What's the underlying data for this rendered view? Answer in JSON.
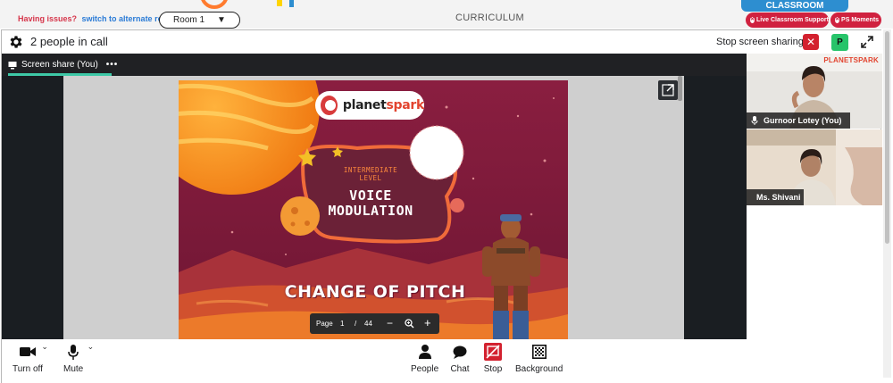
{
  "top_bar": {
    "issue_text": "Having issues?",
    "alternate_link": "switch to alternate room",
    "room_label": "Room 1",
    "curriculum_label": "CURRICULUM",
    "classroom_tab": "CLASSROOM",
    "live_support": "Live Classroom Support",
    "ps_moments": "PS Moments"
  },
  "meeting": {
    "people_count": "2 people in call",
    "stop_share_label": "Stop screen sharing",
    "avatar_letter": "P"
  },
  "share": {
    "tab_label": "Screen share (You)",
    "tab_more": "•••"
  },
  "slide": {
    "brand_main": "planet",
    "brand_accent": "spark",
    "level": "INTERMEDIATE LEVEL",
    "title_line1": "VOICE",
    "title_line2": "MODULATION",
    "subtitle": "CHANGE OF PITCH",
    "page_label": "Page",
    "page_current": "1",
    "page_sep": "/",
    "page_total": "44"
  },
  "participants": [
    {
      "name": "Gurnoor Lotey (You)",
      "logo": "PLANETSPARK"
    },
    {
      "name": "Ms. Shivani"
    }
  ],
  "toolbar": {
    "turn_off": "Turn off",
    "mute": "Mute",
    "people": "People",
    "chat": "Chat",
    "stop": "Stop",
    "background": "Background"
  },
  "colors": {
    "accent_red": "#d0213f",
    "accent_blue": "#2d8ed0",
    "tab_indicator": "#3ec9a7",
    "stage_bg": "#202124"
  }
}
